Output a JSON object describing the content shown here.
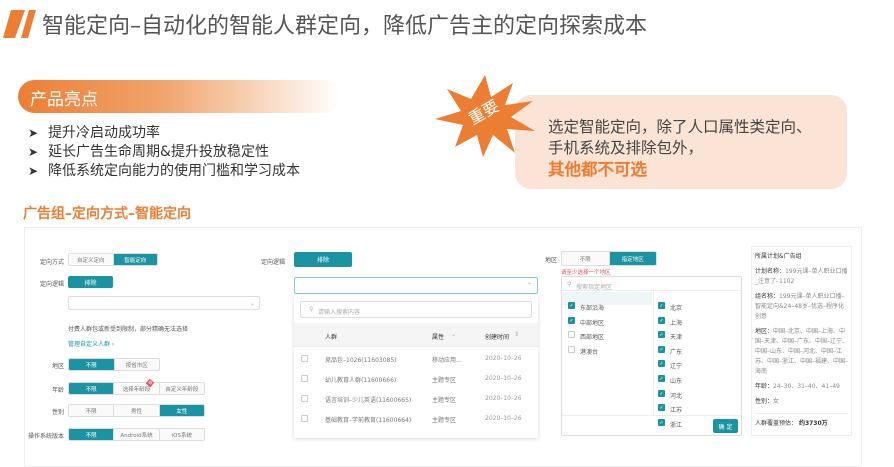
{
  "slide": {
    "title": "智能定向–自动化的智能人群定向，降低广告主的定向探索成本",
    "highlights_label": "产品亮点",
    "bullets": [
      "提升冷启动成功率",
      "延长广告生命周期&提升投放稳定性",
      "降低系统定向能力的使用门槛和学习成本"
    ],
    "badge": "重要",
    "callout_line1": "选定智能定向，除了人口属性类定向、",
    "callout_line2": "手机系统及排除包外，",
    "callout_emphasis": "其他都不可选",
    "section_title": "广告组–定向方式–智能定向",
    "accent": "#ec7e33",
    "teal": "#1a94a3"
  },
  "form": {
    "targeting_method_label": "定向方式",
    "targeting_method_options": [
      "自定义定向",
      "智能定向"
    ],
    "logic_label": "定向逻辑",
    "logic_button": "排除",
    "note": "付费人群包或新受到限制，部分精确无法选择",
    "manage_link": "管理自定义人群 ›",
    "region_label": "地区",
    "region_options": [
      "不限",
      "按省市区"
    ],
    "age_label": "年龄",
    "age_options": [
      "不限",
      "选择年龄段",
      "自定义年龄段"
    ],
    "age_tag": "新",
    "gender_label": "性别",
    "gender_options": [
      "不限",
      "男性",
      "女性"
    ],
    "os_label": "操作系统版本",
    "os_options": [
      "不限",
      "Android系统",
      "iOS系统"
    ]
  },
  "audience": {
    "logic_label": "定向逻辑",
    "logic_button": "排除",
    "search_placeholder": "请输入搜索内容",
    "headers": [
      "人群",
      "属性",
      "创建时间"
    ],
    "rows": [
      {
        "name": "竞品包–1026(11603085)",
        "attr": "移动应用...",
        "date": "2020–10–26"
      },
      {
        "name": "幼儿教育人群(11600666)",
        "attr": "主题专区",
        "date": "2020–10–26"
      },
      {
        "name": "语言培训–少儿英语(11600665)",
        "attr": "主题专区",
        "date": "2020–10–26"
      },
      {
        "name": "基础教育–学前教育(11600664)",
        "attr": "主题专区",
        "date": "2020–10–26"
      }
    ]
  },
  "region": {
    "label": "地区",
    "options": [
      "不限",
      "指定地区"
    ],
    "error": "请至少选择一个地区",
    "search_placeholder": "搜索指定地区",
    "zones": [
      {
        "name": "东部沿海",
        "checked": true
      },
      {
        "name": "中部地区",
        "checked": true
      },
      {
        "name": "西部地区",
        "checked": false
      },
      {
        "name": "港澳台",
        "checked": false
      }
    ],
    "provinces": [
      "北京",
      "上海",
      "天津",
      "广东",
      "辽宁",
      "山东",
      "河北",
      "江苏",
      "浙江"
    ],
    "confirm": "确 定"
  },
  "summary": {
    "title": "所属计划&广告组",
    "plan_label": "计划名称：",
    "plan": "199元课–单人职业口播_注意了–1102",
    "group_label": "组名称：",
    "group": "199元课–单人职业口播–智能定向&24–48岁–优选–程序化创意",
    "region_label": "地区：",
    "region": "中国–北京、中国–上海、中国–天津、中国–广东、中国–辽宁、中国–山东、中国–河北、中国–江苏、中国–浙江、中国–福建、中国–海南",
    "age_label": "年龄：",
    "age": "24–30、31–40、41–49",
    "gender_label": "性别：",
    "gender": "女",
    "estimate_label": "人群覆盖预估：",
    "estimate": "约3730万"
  }
}
